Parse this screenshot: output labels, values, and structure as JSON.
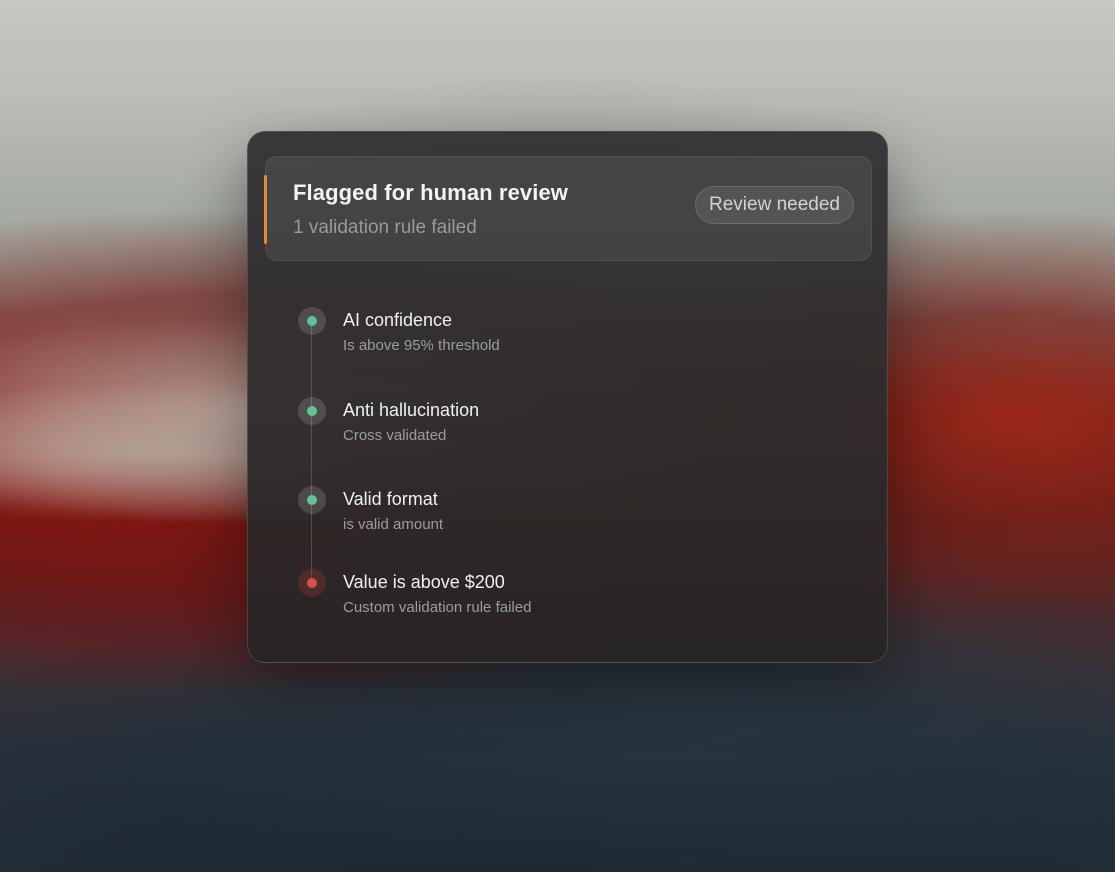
{
  "colors": {
    "accent": "#e8893a",
    "pass": "#5fc494",
    "fail": "#e04e48"
  },
  "header": {
    "title": "Flagged for human review",
    "subtitle": "1 validation rule failed",
    "badge": "Review needed"
  },
  "steps": [
    {
      "title": "AI confidence",
      "description": "Is above 95% threshold",
      "status": "pass",
      "icon": "check-dot-icon"
    },
    {
      "title": "Anti hallucination",
      "description": "Cross validated",
      "status": "pass",
      "icon": "check-dot-icon"
    },
    {
      "title": "Valid format",
      "description": "is valid amount",
      "status": "pass",
      "icon": "check-dot-icon"
    },
    {
      "title": "Value is above $200",
      "description": "Custom validation rule failed",
      "status": "fail",
      "icon": "fail-dot-icon"
    }
  ]
}
